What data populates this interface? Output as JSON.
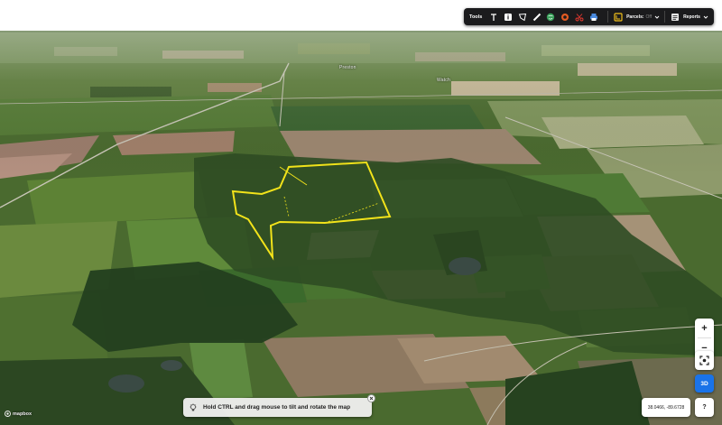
{
  "map": {
    "place_labels": [
      "Preston",
      "Watch"
    ],
    "parcel_color": "#f2e31a",
    "sky_color": "#ffffff",
    "field_colors": [
      "#6b8a3e",
      "#4f7030",
      "#8c7a5c",
      "#a18c73",
      "#3f5a2b",
      "#233f1f"
    ]
  },
  "toolbar": {
    "tools_label": "Tools",
    "icons": [
      "text-icon",
      "info-icon",
      "polygon-icon",
      "ruler-icon",
      "globe-icon",
      "circle-icon",
      "scissors-icon",
      "print-icon"
    ],
    "parcels_label": "Parcels:",
    "parcels_value": "Off",
    "reports_label": "Reports"
  },
  "controls": {
    "zoom_in": "+",
    "zoom_out": "−",
    "view_3d": "3D",
    "help": "?"
  },
  "coords": "38.0466, -89.6728",
  "tip": {
    "text": "Hold CTRL and drag mouse to tilt and rotate the map"
  },
  "attribution": {
    "logo_text": "mapbox"
  }
}
